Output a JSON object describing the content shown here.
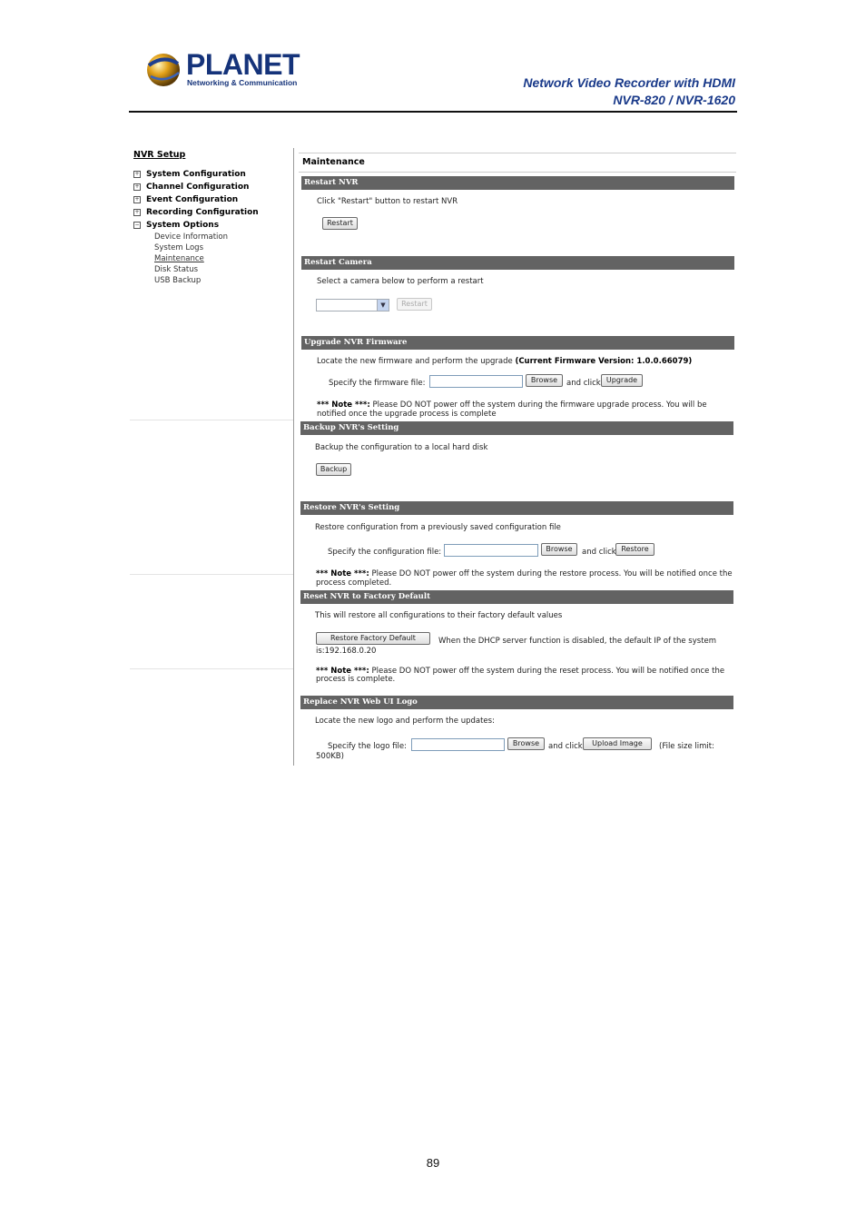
{
  "header": {
    "logo": {
      "name": "PLANET",
      "tagline": "Networking & Communication"
    },
    "title_line1": "Network Video Recorder with HDMI",
    "title_line2": "NVR-820 / NVR-1620"
  },
  "sidebar": {
    "title": "NVR Setup",
    "items": [
      {
        "label": "System Configuration",
        "expander": "+"
      },
      {
        "label": "Channel Configuration",
        "expander": "+"
      },
      {
        "label": "Event Configuration",
        "expander": "+"
      },
      {
        "label": "Recording Configuration",
        "expander": "+"
      },
      {
        "label": "System Options",
        "expander": "−"
      }
    ],
    "subitems": [
      "Device Information",
      "System Logs",
      "Maintenance",
      "Disk Status",
      "USB Backup"
    ]
  },
  "main": {
    "title": "Maintenance",
    "restart_nvr": {
      "header": "Restart NVR",
      "desc": "Click \"Restart\" button to restart NVR",
      "button": "Restart"
    },
    "restart_camera": {
      "header": "Restart Camera",
      "desc": "Select a camera below to perform a restart",
      "select_value": "",
      "button": "Restart"
    },
    "upgrade": {
      "header": "Upgrade NVR Firmware",
      "desc": "Locate the new firmware and perform the upgrade",
      "version": "(Current Firmware Version: 1.0.0.66079)",
      "file_label": "Specify the firmware file:",
      "file_value": "",
      "browse": "Browse",
      "and_click": "and click",
      "button": "Upgrade",
      "note_prefix": "*** Note ***:",
      "note_line1": "Please DO NOT power off the system during the firmware upgrade process. You will be",
      "note_line2": "notified once the upgrade process is complete"
    },
    "backup": {
      "header": "Backup NVR's Setting",
      "desc": "Backup the configuration to a local hard disk",
      "button": "Backup"
    },
    "restore": {
      "header": "Restore NVR's Setting",
      "desc": "Restore configuration from a previously saved configuration file",
      "file_label": "Specify the configuration file:",
      "file_value": "",
      "browse": "Browse",
      "and_click": "and click",
      "button": "Restore",
      "note_prefix": "*** Note ***:",
      "note_line1": "Please DO NOT power off the system during the restore process. You will be notified once the",
      "note_line2": "process completed."
    },
    "factory": {
      "header": "Reset NVR to Factory Default",
      "desc": "This will restore all configurations to their factory default values",
      "button": "Restore Factory Default",
      "info_line1": "When the DHCP server function is disabled, the default IP of the system",
      "info_line2": "is:192.168.0.20",
      "note_prefix": "*** Note ***:",
      "note_line1": "Please DO NOT power off the system during the reset process. You will be notified once the",
      "note_line2": "process is complete."
    },
    "logo": {
      "header": "Replace NVR Web UI Logo",
      "desc": "Locate the new logo and perform the updates:",
      "file_label": "Specify the logo file:",
      "file_value": "",
      "browse": "Browse",
      "and_click": "and click",
      "button": "Upload Image",
      "limit_line1": "(File size limit:",
      "limit_line2": "500KB)"
    }
  },
  "footer": {
    "page_number": "89"
  }
}
